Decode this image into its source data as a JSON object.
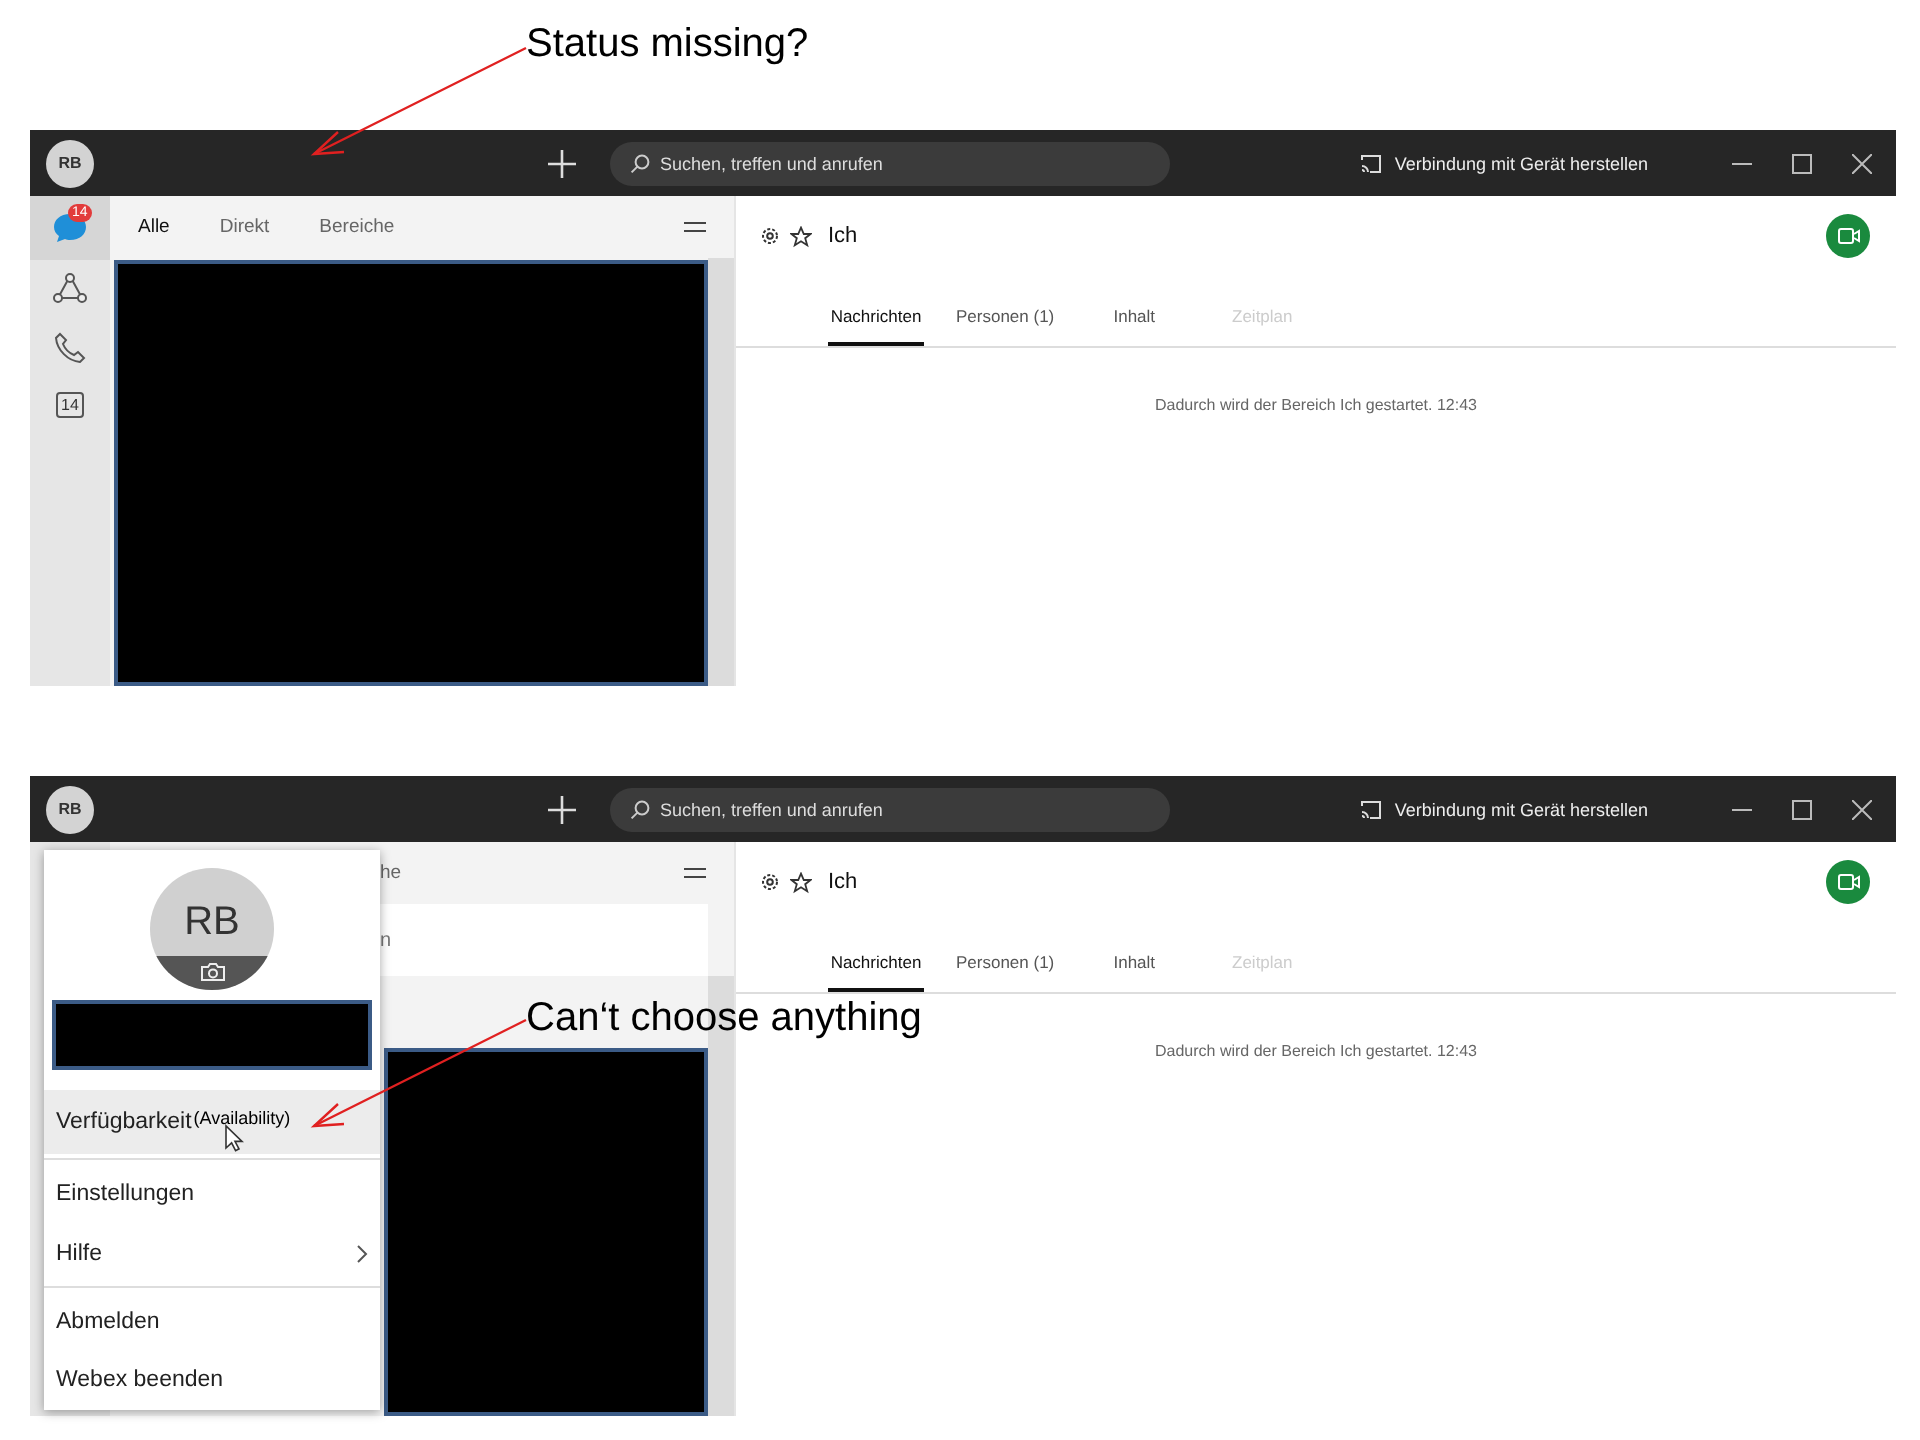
{
  "screens": [
    {
      "annotation": "Status missing?",
      "avatar": "RB",
      "search_placeholder": "Suchen, treffen und anrufen",
      "connect": "Verbindung mit Gerät herstellen",
      "nav": [
        {
          "kind": "messaging",
          "selected": true,
          "badge": "14"
        },
        {
          "kind": "teams",
          "selected": false
        },
        {
          "kind": "calls",
          "selected": false
        },
        {
          "kind": "calendar",
          "selected": false,
          "label": "14"
        }
      ],
      "list_tabs": [
        {
          "label": "Alle",
          "selected": true
        },
        {
          "label": "Direkt",
          "selected": false
        },
        {
          "label": "Bereiche",
          "selected": false
        }
      ],
      "space_title": "Ich",
      "space_tabs": [
        {
          "label": "Nachrichten",
          "selected": true,
          "disabled": false
        },
        {
          "label": "Personen (1)",
          "selected": false,
          "disabled": false
        },
        {
          "label": "Inhalt",
          "selected": false,
          "disabled": false
        },
        {
          "label": "Zeitplan",
          "selected": false,
          "disabled": true
        }
      ],
      "activity": "Dadurch wird der Bereich Ich gestartet. 12:43"
    },
    {
      "annotation": "Can‘t choose anything",
      "avatar": "RB",
      "search_placeholder": "Suchen, treffen und anrufen",
      "connect": "Verbindung mit Gerät herstellen",
      "list_tabs": [
        {
          "label": "he",
          "selected": false
        }
      ],
      "list_row": "n",
      "space_title": "Ich",
      "space_tabs": [
        {
          "label": "Nachrichten",
          "selected": true,
          "disabled": false
        },
        {
          "label": "Personen (1)",
          "selected": false,
          "disabled": false
        },
        {
          "label": "Inhalt",
          "selected": false,
          "disabled": false
        },
        {
          "label": "Zeitplan",
          "selected": false,
          "disabled": true
        }
      ],
      "activity": "Dadurch wird der Bereich Ich gestartet. 12:43",
      "profile_menu": {
        "initials": "RB",
        "items": [
          {
            "label": "Verfügbarkeit",
            "note": "(Availability)",
            "hovered": true,
            "submenu": false,
            "divider_before": false
          },
          {
            "label": "Einstellungen",
            "hovered": false,
            "submenu": false,
            "divider_before": true
          },
          {
            "label": "Hilfe",
            "hovered": false,
            "submenu": true,
            "divider_before": false
          },
          {
            "label": "Abmelden",
            "hovered": false,
            "submenu": false,
            "divider_before": true
          },
          {
            "label": "Webex beenden",
            "hovered": false,
            "submenu": false,
            "divider_before": false
          }
        ]
      }
    }
  ]
}
